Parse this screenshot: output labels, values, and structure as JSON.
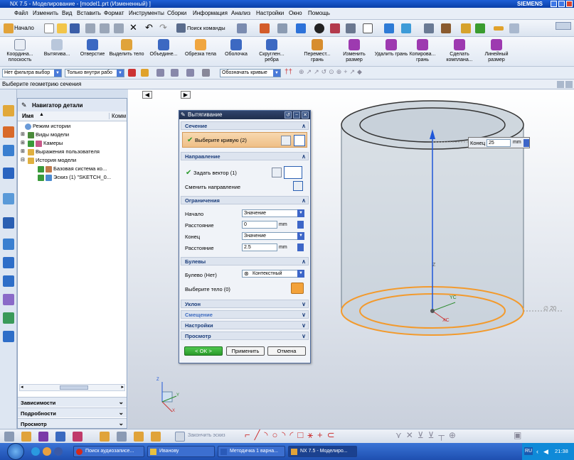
{
  "window": {
    "title": "NX 7.5 - Моделирование - [model1.prt (Измененный) ]",
    "brand": "SIEMENS"
  },
  "menu": [
    "Файл",
    "Изменить",
    "Вид",
    "Вставить",
    "Формат",
    "Инструменты",
    "Сборки",
    "Информация",
    "Анализ",
    "Настройки",
    "Окно",
    "Помощь"
  ],
  "toolbar1": {
    "start_label": "Начало",
    "find_command": "Поиск команды"
  },
  "toolbar2": [
    "Координа... плоскость",
    "Вытягива...",
    "Отверстие",
    "Выделить тело",
    "Объедине...",
    "Обрезка тела",
    "Оболочка",
    "Скруглен... ребра",
    "Перемест... грань",
    "Изменить размер",
    "Удалить грань",
    "Копирова... грань",
    "Сделать компланa...",
    "Линейный размер"
  ],
  "selection_bar": {
    "type_filter": "Нет фильтра выбор",
    "scope": "Только внутри рабо",
    "curve_rule": "Обозначать кривые"
  },
  "cue_line": "Выберите геометрию сечения",
  "navigator": {
    "title": "Навигатор детали",
    "col_name": "Имя",
    "col_comment": "Комм",
    "items": [
      "Режим истории",
      "Виды модели",
      "Камеры",
      "Выражения пользователя",
      "История модели",
      "Базовая система ко...",
      "Эскиз (1) \"SKETCH_0..."
    ],
    "panels": [
      "Зависимости",
      "Подробности",
      "Просмотр"
    ]
  },
  "dialog": {
    "title": "Вытягивание",
    "section_header": "Сечение",
    "select_curve": "Выберите кривую (2)",
    "direction_header": "Направление",
    "specify_vector": "Задать вектор (1)",
    "reverse_direction": "Сменить направление",
    "limits_header": "Ограничения",
    "start_label": "Начало",
    "start_value": "Значение",
    "distance_label": "Расстояние",
    "start_distance": "0",
    "end_label": "Конец",
    "end_value": "Значение",
    "end_distance": "2.5",
    "unit": "mm",
    "boolean_header": "Булевы",
    "boolean_label": "Булево (Нет)",
    "boolean_value": "Контекстный",
    "select_body": "Выберите тело (0)",
    "draft": "Уклон",
    "offset": "Смещение",
    "settings": "Настройки",
    "preview": "Просмотр",
    "ok": "< OK >",
    "apply": "Применить",
    "cancel": "Отмена"
  },
  "viewport": {
    "end_tag_label": "Конец",
    "end_tag_value": "25",
    "end_tag_unit": "mm",
    "dim_label": "∅ 20",
    "axis_z": "Z",
    "axis_yc": "YC",
    "axis_xc": "XC",
    "mini_z": "Z",
    "mini_x": "X",
    "mini_y": "Y"
  },
  "statusbar": {
    "finish_sketch": "Закончить эскиз"
  },
  "taskbar": {
    "tasks": [
      "Поиск аудиозаписе...",
      "Иванову",
      "Методичка 1 варна...",
      "NX 7.5 - Моделиро..."
    ],
    "lang": "RU",
    "time": "21:38"
  },
  "colors": {
    "accent_orange": "#f39a2c",
    "dialog_title": "#2a3b5e",
    "axis_blue": "#1f57d8"
  }
}
